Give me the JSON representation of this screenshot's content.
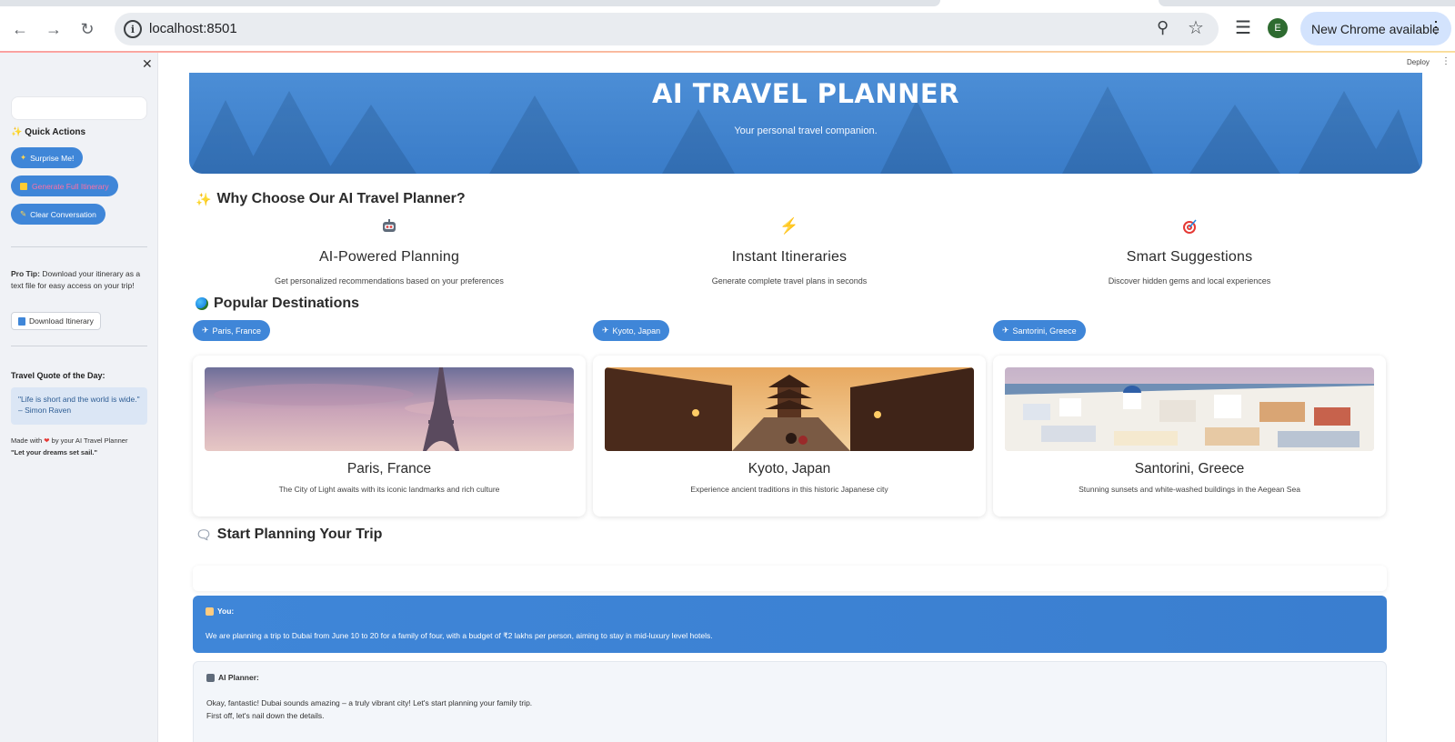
{
  "browser": {
    "url": "localhost:8501",
    "avatar_letter": "E",
    "update_label": "New Chrome available"
  },
  "sidebar": {
    "quick_actions_title": "Quick Actions",
    "buttons": [
      {
        "label": "Surprise Me!",
        "icon": "sparkle-icon"
      },
      {
        "label": "Generate Full Itinerary",
        "icon": "calendar-icon"
      },
      {
        "label": "Clear Conversation",
        "icon": "broom-icon"
      }
    ],
    "pro_tip_label": "Pro Tip:",
    "pro_tip_text": " Download your itinerary as a text file for easy access on your trip!",
    "download_label": "Download Itinerary",
    "quote_title": "Travel Quote of the Day:",
    "quote_text": "\"Life is short and the world is wide.\" – Simon Raven",
    "made_with_prefix": "Made with",
    "made_with_suffix": "by your AI Travel Planner",
    "tagline": "\"Let your dreams set sail.\""
  },
  "header": {
    "deploy_label": "Deploy",
    "title": "AI TRAVEL PLANNER",
    "subtitle": "Your personal travel companion."
  },
  "why_section": {
    "title": "Why Choose Our AI Travel Planner?",
    "features": [
      {
        "icon": "robot-icon",
        "title": "AI-Powered Planning",
        "desc": "Get personalized recommendations based on your preferences"
      },
      {
        "icon": "lightning-icon",
        "title": "Instant Itineraries",
        "desc": "Generate complete travel plans in seconds"
      },
      {
        "icon": "target-icon",
        "title": "Smart Suggestions",
        "desc": "Discover hidden gems and local experiences"
      }
    ]
  },
  "destinations": {
    "title": "Popular Destinations",
    "items": [
      {
        "pill": "Paris, France",
        "name": "Paris, France",
        "desc": "The City of Light awaits with its iconic landmarks and rich culture"
      },
      {
        "pill": "Kyoto, Japan",
        "name": "Kyoto, Japan",
        "desc": "Experience ancient traditions in this historic Japanese city"
      },
      {
        "pill": "Santorini, Greece",
        "name": "Santorini, Greece",
        "desc": "Stunning sunsets and white-washed buildings in the Aegean Sea"
      }
    ]
  },
  "chat": {
    "title": "Start Planning Your Trip",
    "user_label": "You:",
    "user_message": "We are planning a trip to Dubai from June 10 to 20 for a family of four, with a budget of ₹2 lakhs per person, aiming to stay in mid-luxury level hotels.",
    "ai_label": "AI Planner:",
    "ai_line1": "Okay, fantastic! Dubai sounds amazing – a truly vibrant city! Let's start planning your family trip.",
    "ai_line2": "First off, let's nail down the details."
  },
  "colors": {
    "accent": "#3f86d8",
    "sidebar_bg": "#f0f2f6"
  }
}
